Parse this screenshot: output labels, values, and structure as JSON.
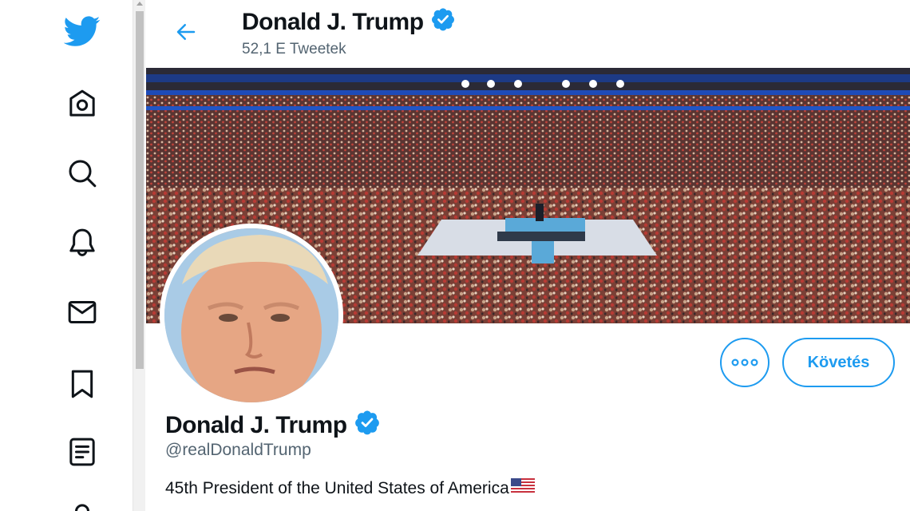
{
  "colors": {
    "accent": "#1d9bf0",
    "text": "#0f1419",
    "secondary_text": "#536471"
  },
  "sidebar": {
    "items": [
      {
        "icon": "twitter-bird-icon"
      },
      {
        "icon": "home-icon"
      },
      {
        "icon": "search-icon"
      },
      {
        "icon": "bell-icon"
      },
      {
        "icon": "mail-icon"
      },
      {
        "icon": "bookmark-icon"
      },
      {
        "icon": "list-icon"
      },
      {
        "icon": "profile-icon"
      }
    ]
  },
  "header": {
    "back_icon": "arrow-left-icon",
    "name": "Donald J. Trump",
    "tweet_count": "52,1 E Tweetek"
  },
  "profile": {
    "name": "Donald J. Trump",
    "handle": "@realDonaldTrump",
    "bio": "45th President of the United States of America",
    "bio_emoji": "us-flag-icon",
    "verified_icon": "verified-badge-icon"
  },
  "actions": {
    "more_icon": "more-dots-icon",
    "follow_label": "Követés"
  }
}
